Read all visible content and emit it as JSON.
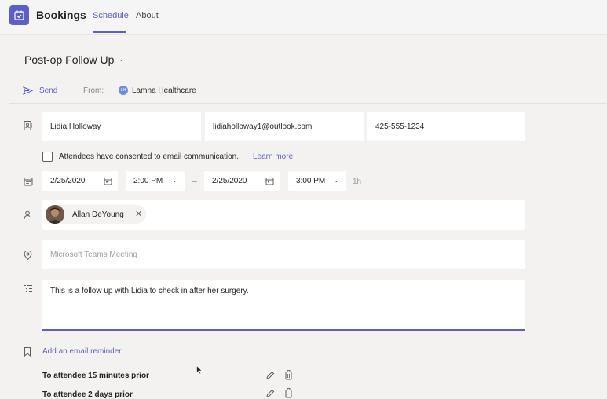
{
  "app": {
    "title": "Bookings",
    "tabs": [
      {
        "label": "Schedule",
        "active": true
      },
      {
        "label": "About",
        "active": false
      }
    ]
  },
  "page": {
    "title": "Post-op Follow Up"
  },
  "toolbar": {
    "send_label": "Send",
    "from_label": "From:",
    "from_avatar_initials": "LH",
    "from_value": "Lamna Healthcare"
  },
  "customer": {
    "name": "Lidia Holloway",
    "email": "lidiaholloway1@outlook.com",
    "phone": "425-555-1234"
  },
  "consent": {
    "checked": false,
    "text": "Attendees have consented to email communication.",
    "link": "Learn more"
  },
  "datetime": {
    "start_date": "2/25/2020",
    "start_time": "2:00 PM",
    "end_date": "2/25/2020",
    "end_time": "3:00 PM",
    "duration": "1h"
  },
  "staff": {
    "name": "Allan DeYoung"
  },
  "location": {
    "placeholder": "Microsoft Teams Meeting"
  },
  "notes": {
    "text": "This is a follow up with Lidia to check in after her surgery."
  },
  "reminders": {
    "add_label": "Add an email reminder",
    "items": [
      {
        "label": "To attendee 15 minutes prior"
      },
      {
        "label": "To attendee 2 days prior"
      }
    ]
  },
  "colors": {
    "accent": "#5b5fc7",
    "background": "#f3f2f1",
    "field": "#ffffff"
  }
}
